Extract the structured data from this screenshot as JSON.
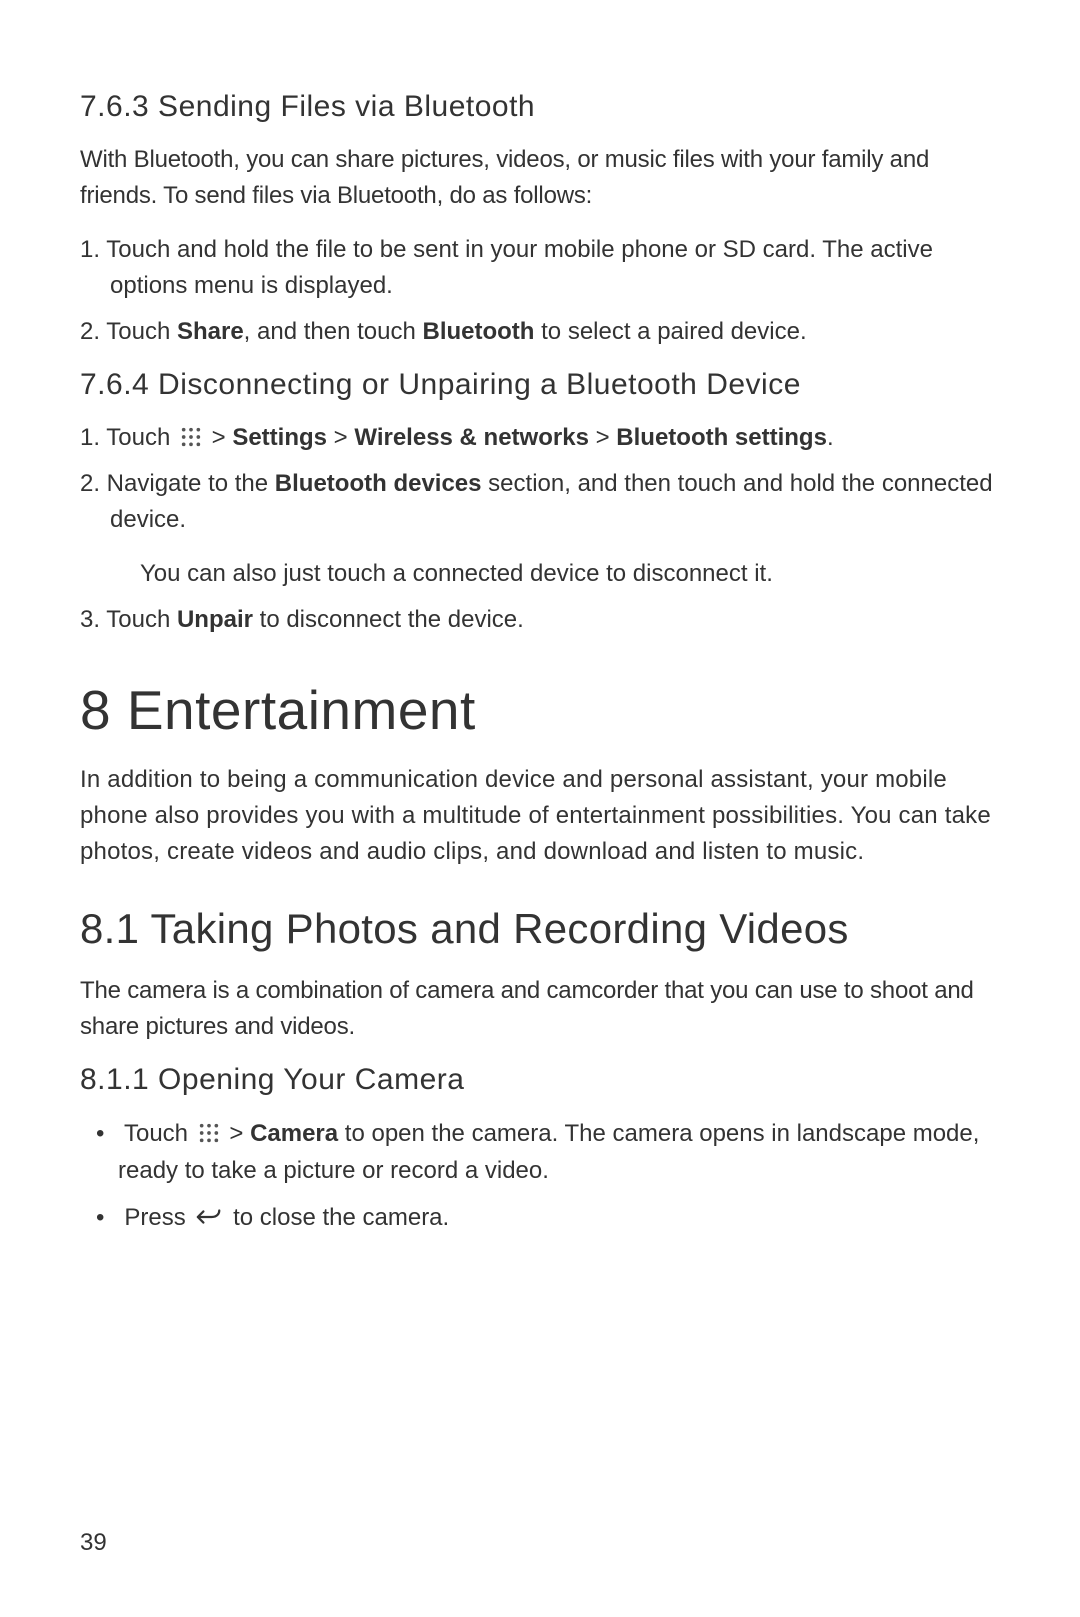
{
  "s763": {
    "heading": "7.6.3  Sending Files via Bluetooth",
    "intro": "With Bluetooth, you can share pictures, videos, or music files with your family and friends. To send files via Bluetooth, do as follows:",
    "step1": "1. Touch and hold the file to be sent in your mobile phone or SD card. The active options menu is displayed.",
    "step2_a": "2. Touch ",
    "step2_b1": "Share",
    "step2_c": ", and then touch ",
    "step2_b2": "Bluetooth",
    "step2_d": " to select a paired device."
  },
  "s764": {
    "heading": "7.6.4  Disconnecting or Unpairing a Bluetooth Device",
    "step1_a": "1. Touch ",
    "step1_b": " > ",
    "step1_settings": "Settings",
    "step1_c": " > ",
    "step1_wireless": "Wireless & networks",
    "step1_d": " > ",
    "step1_bt": "Bluetooth settings",
    "step1_e": ".",
    "step2_a": "2. Navigate to the ",
    "step2_b1": "Bluetooth devices",
    "step2_c": " section, and then touch and hold the connected device.",
    "step2_sub": "You can also just touch a connected device to disconnect it.",
    "step3_a": "3. Touch ",
    "step3_b1": "Unpair",
    "step3_c": " to disconnect the device."
  },
  "s8": {
    "heading": "8  Entertainment",
    "intro": "In addition to being a communication device and personal assistant, your mobile phone also provides you with a multitude of entertainment possibilities. You can take photos, create videos and audio clips, and download and listen to music."
  },
  "s81": {
    "heading": "8.1  Taking Photos and Recording Videos",
    "intro": "The camera is a combination of camera and camcorder that you can use to shoot and share pictures and videos."
  },
  "s811": {
    "heading": "8.1.1  Opening Your Camera",
    "b1_a": "Touch ",
    "b1_b": " > ",
    "b1_camera": "Camera",
    "b1_c": " to open the camera. The camera opens in landscape mode, ready to take a picture or record a video.",
    "b2_a": "Press ",
    "b2_b": " to close the camera."
  },
  "page_number": "39"
}
